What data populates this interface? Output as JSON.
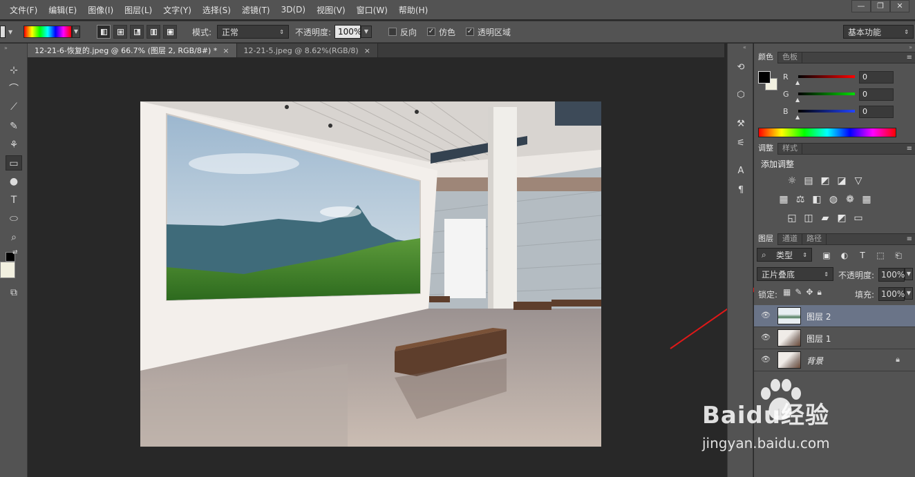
{
  "menubar": {
    "items": [
      "文件(F)",
      "编辑(E)",
      "图像(I)",
      "图层(L)",
      "文字(Y)",
      "选择(S)",
      "滤镜(T)",
      "3D(D)",
      "视图(V)",
      "窗口(W)",
      "帮助(H)"
    ],
    "window_controls": [
      "—",
      "❐",
      "✕"
    ]
  },
  "options": {
    "mode_label": "模式:",
    "mode_value": "正常",
    "opacity_label": "不透明度:",
    "opacity_value": "100%",
    "reverse_label": "反向",
    "dither_label": "仿色",
    "transparency_label": "透明区域",
    "workspace_value": "基本功能"
  },
  "tabs": [
    {
      "label": "12-21-6-恢复的.jpeg @ 66.7% (图层 2, RGB/8#) *",
      "close": "×"
    },
    {
      "label": "12-21-5.jpeg @ 8.62%(RGB/8)",
      "close": "×"
    }
  ],
  "toolbox": {
    "icons": [
      "move-icon",
      "quick-select-icon",
      "eyedropper-icon",
      "brush-icon",
      "clone-stamp-icon",
      "gradient-icon",
      "dodge-icon",
      "type-icon",
      "ellipse-icon",
      "zoom-icon",
      "swap-icon",
      "screen-mode-icon"
    ],
    "glyphs": [
      "⊹",
      "⌒",
      "⟋",
      "✎",
      "⚘",
      "▭",
      "●",
      "T",
      "⬭",
      "⌕",
      "⇄",
      "⧉"
    ],
    "foreground_color": "#000000",
    "background_color": "#f2f0e0"
  },
  "color_panel": {
    "tabs": [
      "颜色",
      "色板"
    ],
    "channels": [
      {
        "label": "R",
        "value": "0",
        "color": "#ff2020"
      },
      {
        "label": "G",
        "value": "0",
        "color": "#20d020"
      },
      {
        "label": "B",
        "value": "0",
        "color": "#2040ff"
      }
    ]
  },
  "adjust_panel": {
    "tabs": [
      "调整",
      "样式"
    ],
    "title": "添加调整",
    "row1": [
      "☼",
      "▤",
      "◩",
      "◪",
      "▽"
    ],
    "row2": [
      "▦",
      "⚖",
      "◧",
      "◍",
      "❁",
      "▦"
    ],
    "row3": [
      "◱",
      "◫",
      "▰",
      "◩",
      "▭"
    ]
  },
  "layers_panel": {
    "tabs": [
      "图层",
      "通道",
      "路径"
    ],
    "filter_label": "类型",
    "filter_icons": [
      "▣",
      "◐",
      "T",
      "⬚",
      "⎗"
    ],
    "blend_mode": "正片叠底",
    "opacity_label": "不透明度:",
    "opacity_value": "100%",
    "lock_label": "锁定:",
    "fill_label": "填充:",
    "fill_value": "100%",
    "layers": [
      {
        "name": "图层 2",
        "selected": true,
        "locked": false
      },
      {
        "name": "图层 1",
        "selected": false,
        "locked": false
      },
      {
        "name": "背景",
        "selected": false,
        "locked": true
      }
    ]
  },
  "watermark": {
    "brand": "Baidu经验",
    "url": "jingyan.baidu.com"
  }
}
